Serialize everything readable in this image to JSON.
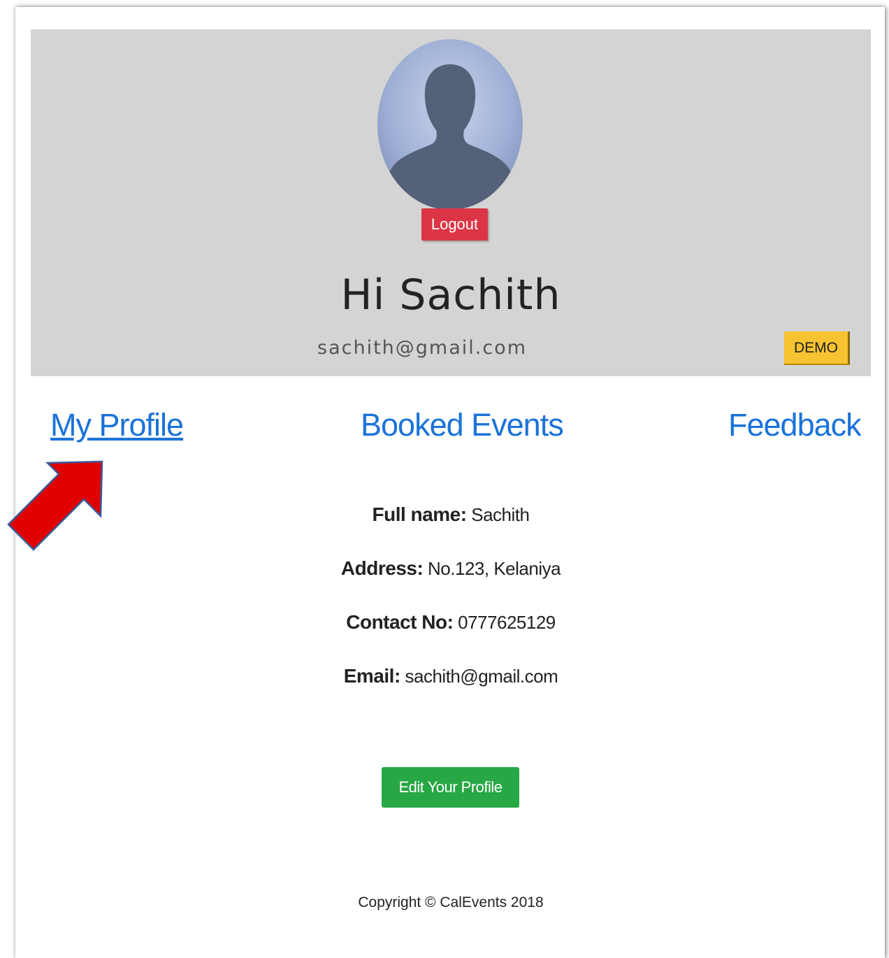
{
  "profile": {
    "greeting": "Hi Sachith",
    "email": "sachith@gmail.com",
    "logout_label": "Logout",
    "badge": "DEMO"
  },
  "nav": {
    "my_profile": "My Profile",
    "booked_events": "Booked Events",
    "feedback": "Feedback"
  },
  "details": {
    "full_name_label": "Full name:",
    "full_name_value": "Sachith",
    "address_label": "Address:",
    "address_value": "No.123, Kelaniya",
    "contact_label": "Contact No:",
    "contact_value": "0777625129",
    "email_label": "Email:",
    "email_value": "sachith@gmail.com"
  },
  "edit_button_label": "Edit Your Profile",
  "footer": {
    "copyright": "Copyright © CalEvents 2018"
  },
  "colors": {
    "hero_bg": "#d4d4d4",
    "link_blue": "#1a73d9",
    "logout_red": "#dc3545",
    "badge_yellow": "#f7c331",
    "edit_green": "#28a745",
    "annotation_arrow": "#e00000"
  },
  "annotation": {
    "arrow_icon": "red-arrow-pointing-to-my-profile"
  }
}
